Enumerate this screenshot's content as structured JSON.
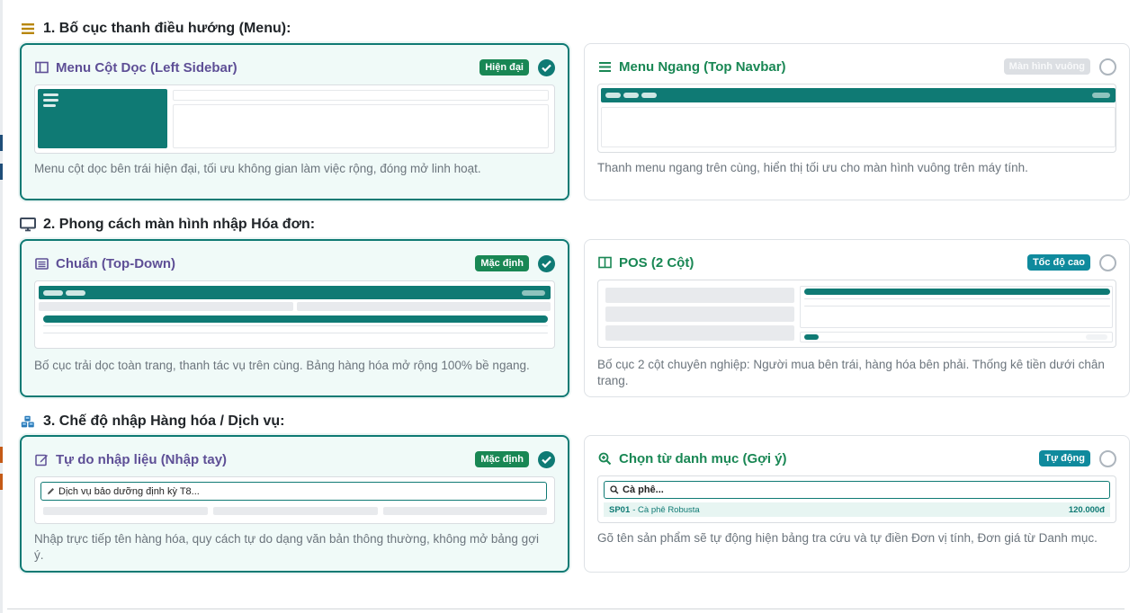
{
  "sections": [
    {
      "title": "1. Bố cục thanh điều hướng (Menu):",
      "icon": "bars-icon",
      "cards": [
        {
          "title": "Menu Cột Dọc (Left Sidebar)",
          "icon": "columns-icon",
          "badge": "Hiện đại",
          "selected": true,
          "description": "Menu cột dọc bên trái hiện đại, tối ưu không gian làm việc rộng, đóng mở linh hoạt."
        },
        {
          "title": "Menu Ngang (Top Navbar)",
          "icon": "bars-icon",
          "badge": "Màn hình vuông",
          "selected": false,
          "description": "Thanh menu ngang trên cùng, hiển thị tối ưu cho màn hình vuông trên máy tính."
        }
      ]
    },
    {
      "title": "2. Phong cách màn hình nhập Hóa đơn:",
      "icon": "desktop-icon",
      "cards": [
        {
          "title": "Chuẩn (Top-Down)",
          "icon": "list-alt-icon",
          "badge": "Mặc định",
          "selected": true,
          "description": "Bố cục trải dọc toàn trang, thanh tác vụ trên cùng. Bảng hàng hóa mở rộng 100% bề ngang."
        },
        {
          "title": "POS (2 Cột)",
          "icon": "columns-icon",
          "badge": "Tốc độ cao",
          "selected": false,
          "description": "Bố cục 2 cột chuyên nghiệp: Người mua bên trái, hàng hóa bên phải. Thống kê tiền dưới chân trang."
        }
      ]
    },
    {
      "title": "3. Chế độ nhập Hàng hóa / Dịch vụ:",
      "icon": "cubes-icon",
      "cards": [
        {
          "title": "Tự do nhập liệu (Nhập tay)",
          "icon": "edit-icon",
          "badge": "Mặc định",
          "selected": true,
          "input_value": "Dịch vụ bảo dưỡng định kỳ T8...",
          "description": "Nhập trực tiếp tên hàng hóa, quy cách tự do dạng văn bản thông thường, không mở bảng gợi ý."
        },
        {
          "title": "Chọn từ danh mục (Gợi ý)",
          "icon": "search-plus-icon",
          "badge": "Tự động",
          "selected": false,
          "search_value": "Cà phê...",
          "suggestion": {
            "code": "SP01",
            "name": "- Cà phê Robusta",
            "price": "120.000đ"
          },
          "description": "Gõ tên sản phẩm sẽ tự động hiện bảng tra cứu và tự điền Đơn vị tính, Đơn giá từ Danh mục."
        }
      ]
    }
  ],
  "colors": {
    "accent": "#0f7a74",
    "selected_bg": "#f0faf8",
    "title_purple": "#5e4f96",
    "title_green": "#198754",
    "badge_green": "#198754",
    "badge_teal": "#0f8a9d",
    "badge_gray": "#dcdfe3"
  }
}
